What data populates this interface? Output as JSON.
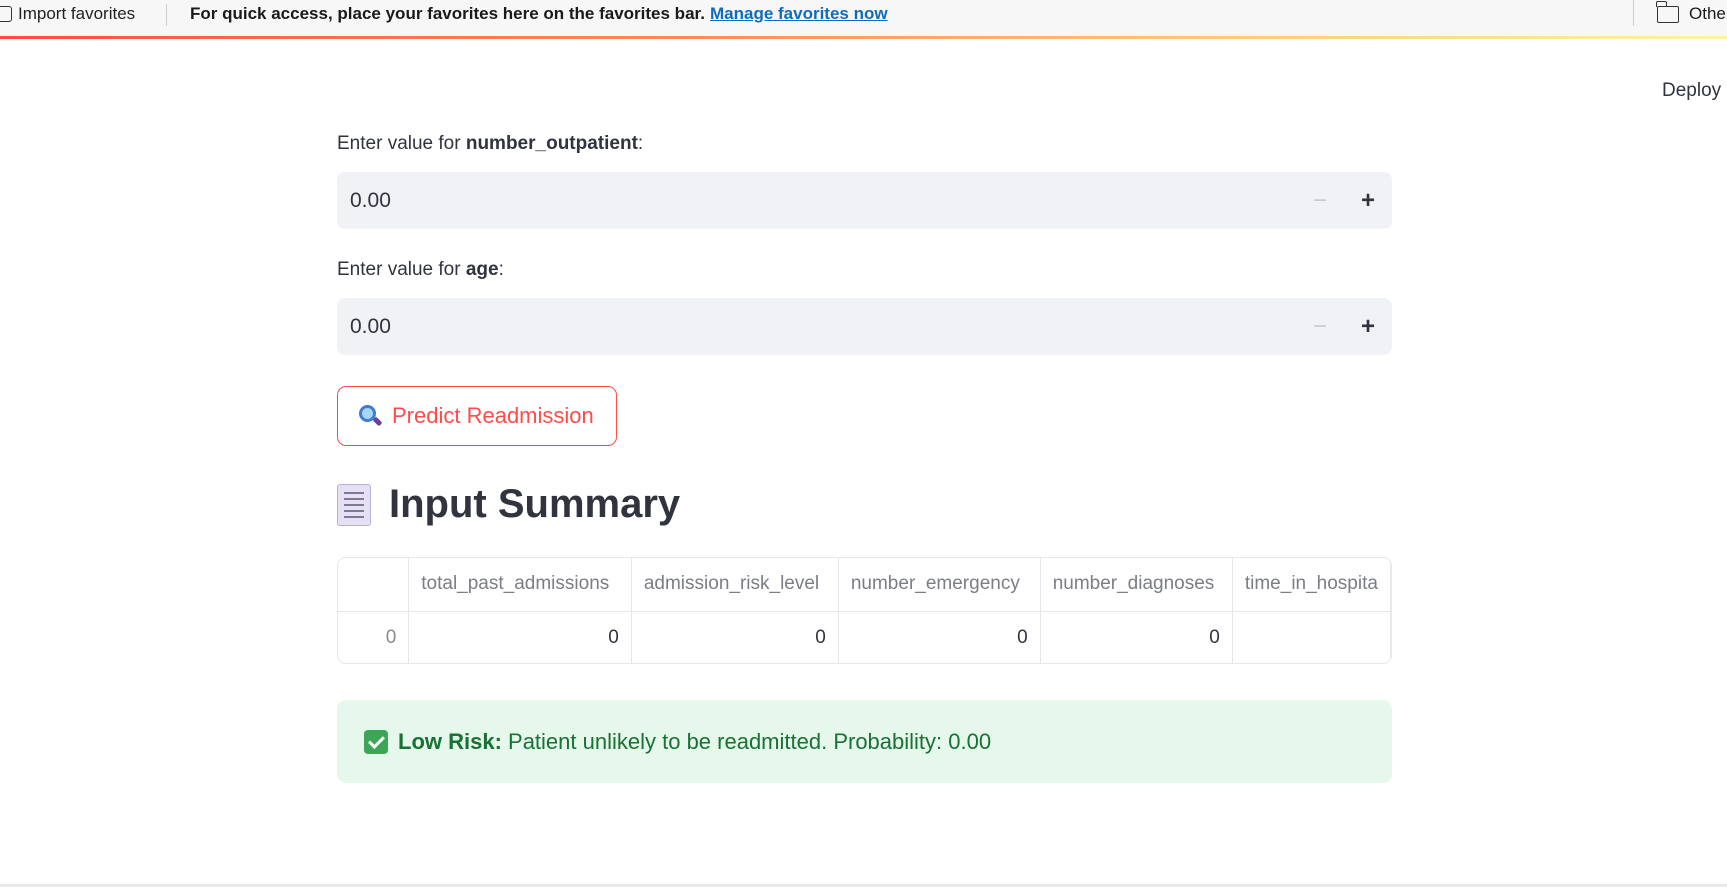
{
  "favorites_bar": {
    "import_label": "Import favorites",
    "message": "For quick access, place your favorites here on the favorites bar.",
    "manage_link": "Manage favorites now",
    "other_label": "Othe"
  },
  "header": {
    "deploy_label": "Deploy"
  },
  "fields": [
    {
      "label_prefix": "Enter value for ",
      "label_name": "number_outpatient",
      "label_suffix": ":",
      "value": "0.00",
      "minus": "−",
      "plus": "+"
    },
    {
      "label_prefix": "Enter value for ",
      "label_name": "age",
      "label_suffix": ":",
      "value": "0.00",
      "minus": "−",
      "plus": "+"
    }
  ],
  "predict_button": {
    "label": "Predict Readmission",
    "icon": "magnifying-glass-icon"
  },
  "summary": {
    "icon": "receipt-icon",
    "title": "Input Summary",
    "columns": [
      "",
      "total_past_admissions",
      "admission_risk_level",
      "number_emergency",
      "number_diagnoses",
      "time_in_hospita"
    ],
    "rows": [
      [
        "0",
        "0",
        "0",
        "0",
        "0",
        ""
      ]
    ]
  },
  "result": {
    "icon": "check-box-icon",
    "strong": "Low Risk:",
    "text": " Patient unlikely to be readmitted. Probability: 0.00",
    "colors": {
      "background": "#e6f7eb",
      "text": "#177233"
    }
  },
  "colors": {
    "accent": "#ff4b4b",
    "input_bg": "#f0f2f6",
    "link": "#0f6cbd"
  }
}
